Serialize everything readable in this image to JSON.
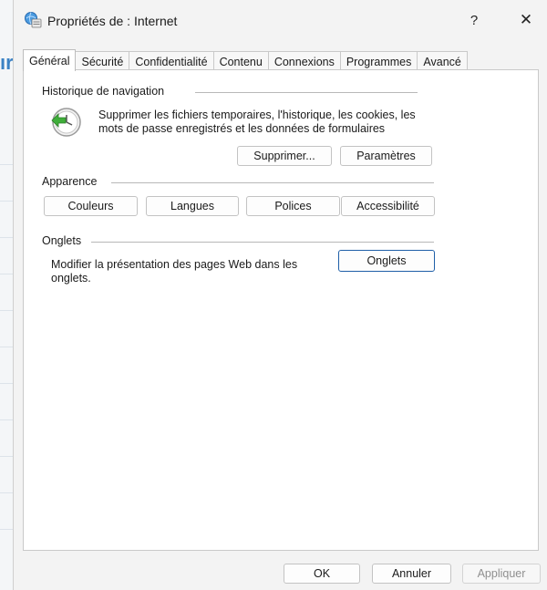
{
  "window": {
    "title": "Propriétés de : Internet",
    "help_glyph": "?",
    "close_glyph": "✕"
  },
  "background": {
    "glyph": "ır"
  },
  "tabs": [
    {
      "label": "Général",
      "active": true
    },
    {
      "label": "Sécurité"
    },
    {
      "label": "Confidentialité"
    },
    {
      "label": "Contenu"
    },
    {
      "label": "Connexions"
    },
    {
      "label": "Programmes"
    },
    {
      "label": "Avancé"
    }
  ],
  "history": {
    "group_label": "Historique de navigation",
    "description_line1": "Supprimer les fichiers temporaires, l'historique, les cookies, les",
    "description_line2": "mots de passe enregistrés et les données de formulaires",
    "delete_button": "Supprimer...",
    "settings_button": "Paramètres",
    "icon": "history-clock-icon"
  },
  "appearance": {
    "group_label": "Apparence",
    "colors_button": "Couleurs",
    "languages_button": "Langues",
    "fonts_button": "Polices",
    "accessibility_button": "Accessibilité"
  },
  "tabs_group": {
    "group_label": "Onglets",
    "description_line1": "Modifier la présentation des pages Web dans les",
    "description_line2": "onglets.",
    "tabs_button": "Onglets"
  },
  "footer": {
    "ok_button": "OK",
    "cancel_button": "Annuler",
    "apply_button": "Appliquer"
  },
  "colors": {
    "accent": "#1f5fa8",
    "dialog_bg": "#f3f3f3",
    "panel_bg": "#ffffff"
  }
}
